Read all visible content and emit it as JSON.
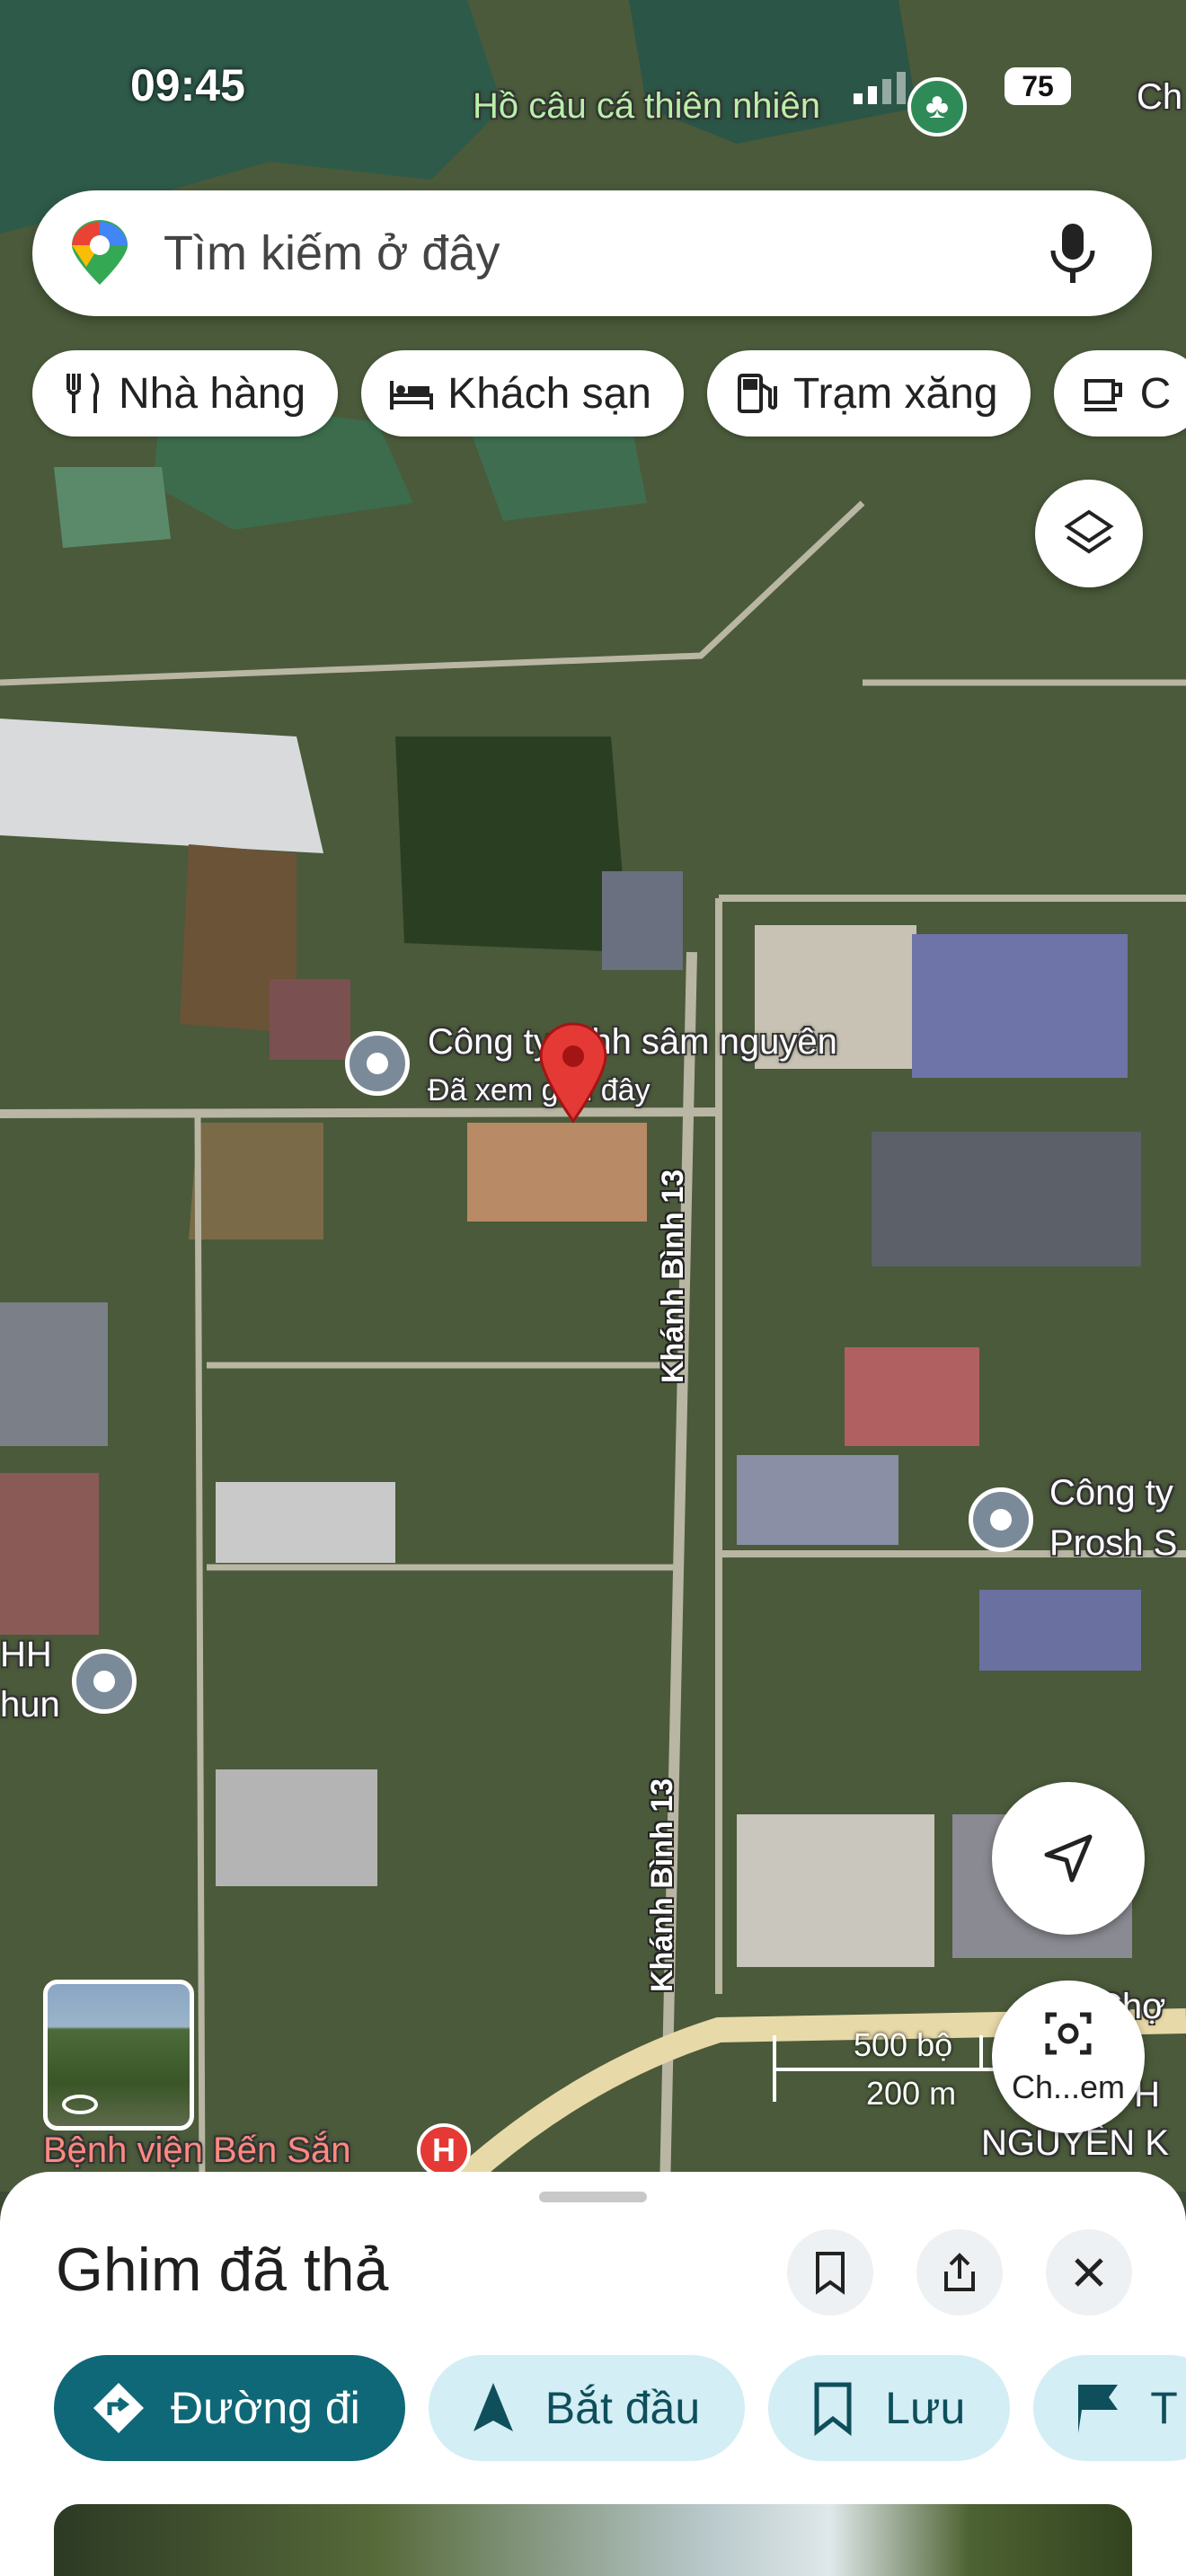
{
  "status_bar": {
    "time": "09:45",
    "battery": "75"
  },
  "search": {
    "placeholder": "Tìm kiếm ở đây"
  },
  "chips": [
    {
      "label": "Nhà hàng",
      "icon": "restaurant-icon"
    },
    {
      "label": "Khách sạn",
      "icon": "hotel-icon"
    },
    {
      "label": "Trạm xăng",
      "icon": "gas-station-icon"
    },
    {
      "label": "C",
      "icon": "coffee-icon"
    }
  ],
  "map": {
    "labels": {
      "lake": "Hồ câu cá thiên nhiên",
      "top_right": "Ch",
      "company_main": "Công ty tnhh sâm nguyên",
      "company_main_sub": "Đã xem gần đây",
      "road_1": "Khánh Bình 13",
      "road_2": "Khánh Bình 13",
      "company_right_1": "Công ty",
      "company_right_2": "Prosh S",
      "left_1": "HH",
      "left_2": "hun",
      "hospital": "Bệnh viện Bến Sắn",
      "market": "Chợ",
      "bottom_right_1": "P H",
      "bottom_right_2": "NGUYÊN K"
    },
    "scale": {
      "feet": "500 bộ",
      "meters": "200 m"
    },
    "lens_label": "Ch...em"
  },
  "sheet": {
    "title": "Ghim đã thả",
    "actions": [
      {
        "label": "Đường đi",
        "icon": "directions-icon"
      },
      {
        "label": "Bắt đầu",
        "icon": "navigation-icon"
      },
      {
        "label": "Lưu",
        "icon": "bookmark-icon"
      },
      {
        "label": "T",
        "icon": "flag-icon"
      }
    ]
  },
  "colors": {
    "accent": "#0f6877",
    "chip_light": "#d3eef4",
    "pin_red": "#e53935"
  }
}
